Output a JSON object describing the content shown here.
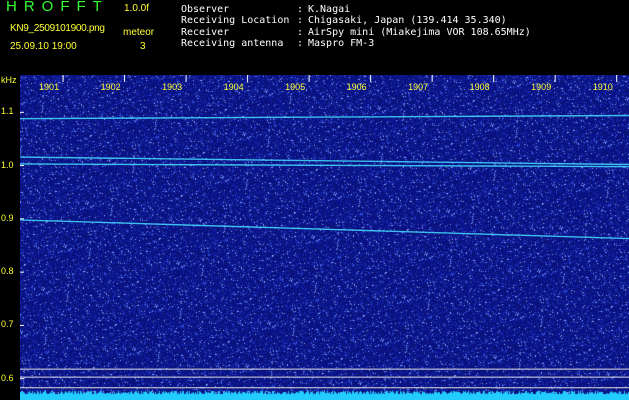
{
  "header": {
    "app_title": "HROFFT",
    "version": "1.0.0f",
    "file_name": "KN9_2509101900.png",
    "mode_label": "meteor",
    "date_time": "25.09.10 19:00",
    "mode_value": "3",
    "info": [
      {
        "label": "Observer",
        "value": "K.Nagai"
      },
      {
        "label": "Receiving Location",
        "value": "Chigasaki, Japan (139.414 35.340)"
      },
      {
        "label": "Receiver",
        "value": "AirSpy mini (Miakejima VOR 108.65MHz)"
      },
      {
        "label": "Receiving antenna",
        "value": "Maspro FM-3"
      }
    ],
    "separator": ":"
  },
  "colors": {
    "title": "#33ff33",
    "yellow": "#ffff33",
    "white": "#ffffff",
    "background": "#000000",
    "noise_base": "#0a1580",
    "trace": "#44ddff"
  },
  "chart_data": {
    "type": "heatmap",
    "y_unit": "kHz",
    "y_ticks": [
      "1.1",
      "1.0",
      "0.9",
      "0.8",
      "0.7",
      "0.6"
    ],
    "y_tick_values": [
      1.1,
      1.0,
      0.9,
      0.8,
      0.7,
      0.6
    ],
    "ylim": [
      0.56,
      1.17
    ],
    "x_ticks": [
      "1901",
      "1902",
      "1903",
      "1904",
      "1905",
      "1906",
      "1907",
      "1908",
      "1909",
      "1910"
    ],
    "x_tick_minutes": [
      1,
      2,
      3,
      4,
      5,
      6,
      7,
      8,
      9,
      10
    ],
    "xlim_minutes": [
      0.3,
      10.2
    ],
    "traces": [
      {
        "y_start": 1.088,
        "y_end": 1.094
      },
      {
        "y_start": 1.016,
        "y_end": 1.002
      },
      {
        "y_start": 1.003,
        "y_end": 0.998
      },
      {
        "y_start": 0.898,
        "y_end": 0.863
      }
    ],
    "reference_lines_khz": [
      0.618,
      0.603,
      0.583
    ]
  }
}
